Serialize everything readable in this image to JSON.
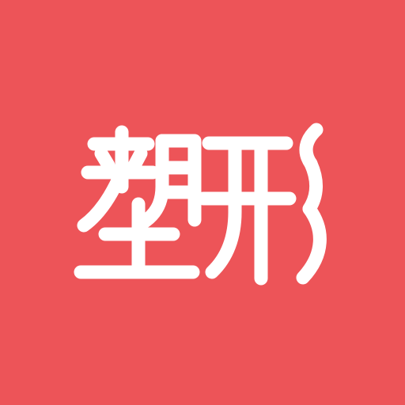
{
  "icon": {
    "wordmark": "塑形",
    "background_color": "#ED5458",
    "foreground_color": "#FFFFFF"
  }
}
